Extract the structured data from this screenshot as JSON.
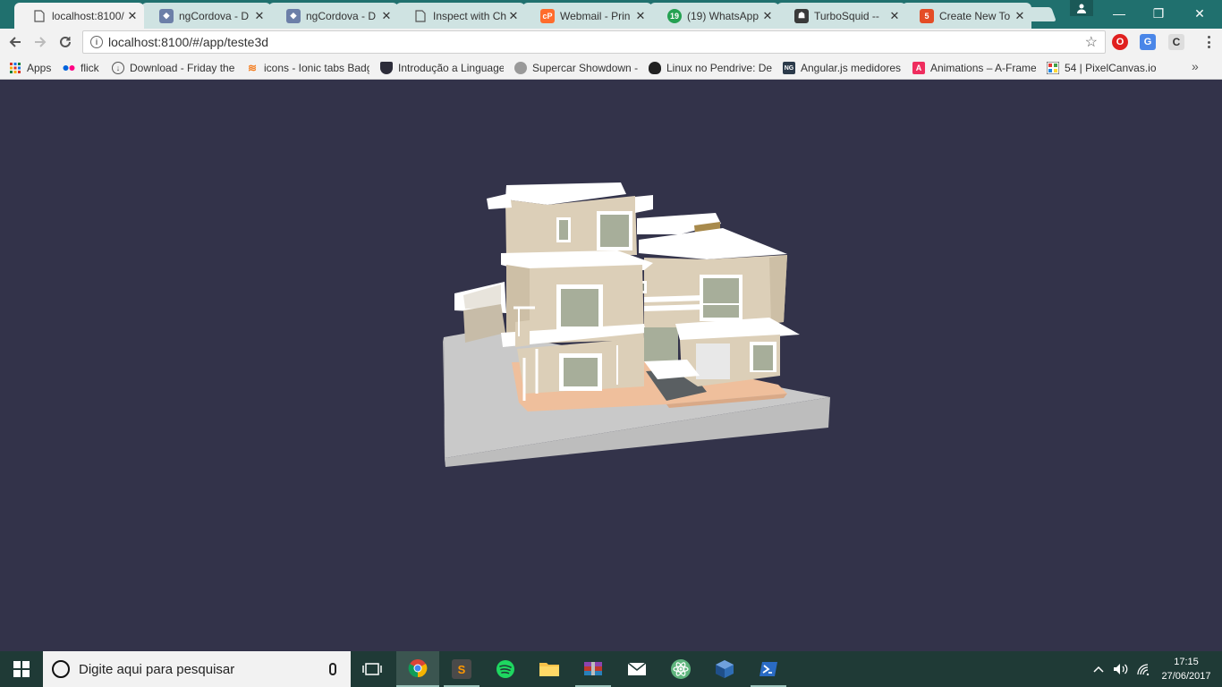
{
  "browser": {
    "tabs": [
      {
        "title": "localhost:8100/",
        "icon": "page-icon",
        "active": true
      },
      {
        "title": "ngCordova - D",
        "icon": "shield-icon",
        "active": false
      },
      {
        "title": "ngCordova - D",
        "icon": "shield-icon",
        "active": false
      },
      {
        "title": "Inspect with Ch",
        "icon": "page-icon",
        "active": false
      },
      {
        "title": "Webmail - Prin",
        "icon": "cpanel-icon",
        "active": false
      },
      {
        "title": "(19) WhatsApp",
        "icon": "whatsapp-icon",
        "active": false
      },
      {
        "title": "TurboSquid -- ",
        "icon": "turbosquid-icon",
        "active": false
      },
      {
        "title": "Create New To",
        "icon": "html5-icon",
        "active": false
      }
    ],
    "whatsapp_badge": "19",
    "address": "localhost:8100/#/app/teste3d",
    "extension_badge": "off",
    "bookmarks": [
      {
        "label": "Apps",
        "icon": "apps-grid-icon"
      },
      {
        "label": "flick",
        "icon": "flickr-icon"
      },
      {
        "label": "Download - Friday the",
        "icon": "download-icon"
      },
      {
        "label": "icons - Ionic tabs Badg",
        "icon": "stackoverflow-icon"
      },
      {
        "label": "Introdução a Linguage",
        "icon": "shield-dark-icon"
      },
      {
        "label": "Supercar Showdown -",
        "icon": "globe-icon"
      },
      {
        "label": "Linux no Pendrive: De",
        "icon": "tux-icon"
      },
      {
        "label": "Angular.js medidores",
        "icon": "ng-icon",
        "icon_text": "NG"
      },
      {
        "label": "Animations – A-Frame",
        "icon": "aframe-icon",
        "icon_text": "A"
      },
      {
        "label": "54 | PixelCanvas.io",
        "icon": "pixelcanvas-icon"
      }
    ]
  },
  "scene": {
    "background": "#33334a",
    "ground_color": "#c8c8c8",
    "wall_color": "#dccfb8",
    "slab_color": "#ffffff",
    "floor_color": "#efbf9c",
    "glass_color": "#a7ae9a"
  },
  "taskbar": {
    "search_placeholder": "Digite aqui para pesquisar",
    "time": "17:15",
    "date": "27/06/2017"
  }
}
